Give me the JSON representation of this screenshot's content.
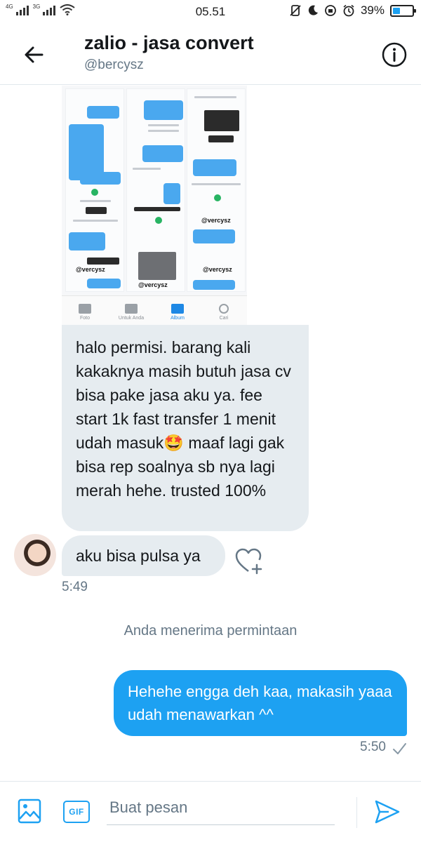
{
  "status_bar": {
    "network_left": "4G",
    "network_right": "3G",
    "time": "05.51",
    "battery_percent": "39%",
    "battery_level": 0.39
  },
  "header": {
    "title": "zalio - jasa convert",
    "handle": "@bercysz"
  },
  "image_message": {
    "watermark": "@vercysz",
    "gallery_tabs": [
      {
        "label": "Foto",
        "active": false
      },
      {
        "label": "Untuk Anda",
        "active": false
      },
      {
        "label": "Album",
        "active": true
      },
      {
        "label": "Cari",
        "active": false
      }
    ]
  },
  "messages": {
    "received_1": "halo permisi. barang kali kakaknya masih butuh jasa cv bisa pake jasa aku ya. fee start 1k fast transfer 1 menit udah masuk🤩 maaf lagi gak bisa rep soalnya sb nya lagi merah hehe. trusted 100%",
    "received_2": "aku bisa pulsa ya",
    "received_time": "5:49",
    "system": "Anda menerima permintaan",
    "sent_1": "Hehehe engga deh kaa, makasih yaaa udah menawarkan ^^",
    "sent_time": "5:50"
  },
  "composer": {
    "placeholder": "Buat pesan",
    "gif_label": "GIF"
  },
  "colors": {
    "accent": "#1da1f2",
    "bubble_in": "#e6ecf0",
    "muted_text": "#657786"
  }
}
